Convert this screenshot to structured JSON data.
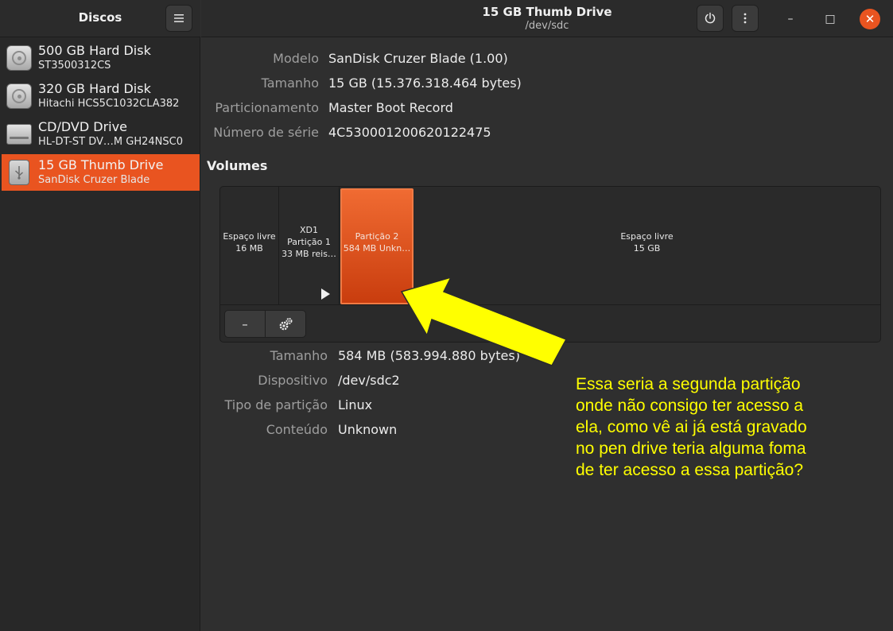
{
  "sidebar": {
    "title": "Discos",
    "menu_icon": "hamburger-menu-icon",
    "disks": [
      {
        "name": "500 GB Hard Disk",
        "model": "ST3500312CS",
        "icon": "hard-disk-icon"
      },
      {
        "name": "320 GB Hard Disk",
        "model": "Hitachi HCS5C1032CLA382",
        "icon": "hard-disk-icon"
      },
      {
        "name": "CD/DVD Drive",
        "model": "HL-DT-ST DV…M GH24NSC0",
        "icon": "optical-drive-icon"
      },
      {
        "name": "15 GB Thumb Drive",
        "model": "SanDisk Cruzer Blade",
        "icon": "usb-drive-icon",
        "selected": true
      }
    ]
  },
  "header": {
    "title": "15 GB Thumb Drive",
    "subtitle": "/dev/sdc",
    "power_icon": "power-icon",
    "more_icon": "vertical-ellipsis-icon",
    "minimize": "–",
    "maximize": "□",
    "close": "✕"
  },
  "drive_info": [
    {
      "label": "Modelo",
      "value": "SanDisk Cruzer Blade (1.00)"
    },
    {
      "label": "Tamanho",
      "value": "15 GB (15.376.318.464 bytes)"
    },
    {
      "label": "Particionamento",
      "value": "Master Boot Record"
    },
    {
      "label": "Número de série",
      "value": "4C530001200620122475"
    }
  ],
  "volumes": {
    "heading": "Volumes",
    "segments": [
      {
        "lines": [
          "Espaço livre",
          "16 MB"
        ]
      },
      {
        "lines": [
          "XD1",
          "Partição 1",
          "33 MB reis…"
        ]
      },
      {
        "lines": [
          "Partição 2",
          "584 MB Unkn…"
        ],
        "selected": true
      },
      {
        "lines": [
          "Espaço livre",
          "15 GB"
        ]
      }
    ],
    "minus_label": "–",
    "gear_icon": "gears-icon"
  },
  "partition_info": [
    {
      "label": "Tamanho",
      "value": "584 MB (583.994.880 bytes)"
    },
    {
      "label": "Dispositivo",
      "value": "/dev/sdc2"
    },
    {
      "label": "Tipo de partição",
      "value": "Linux"
    },
    {
      "label": "Conteúdo",
      "value": "Unknown"
    }
  ],
  "annotation": {
    "lines": [
      "Essa seria a segunda partição",
      "onde não consigo ter acesso a",
      "ela, como vê ai já está gravado",
      "no pen drive teria alguma foma",
      "de ter acesso a essa partição?"
    ],
    "color": "#ffff00",
    "arrow_color": "#ffff00"
  },
  "colors": {
    "accent": "#e95420",
    "background": "#2f2f2f",
    "sidebar": "#282828"
  }
}
